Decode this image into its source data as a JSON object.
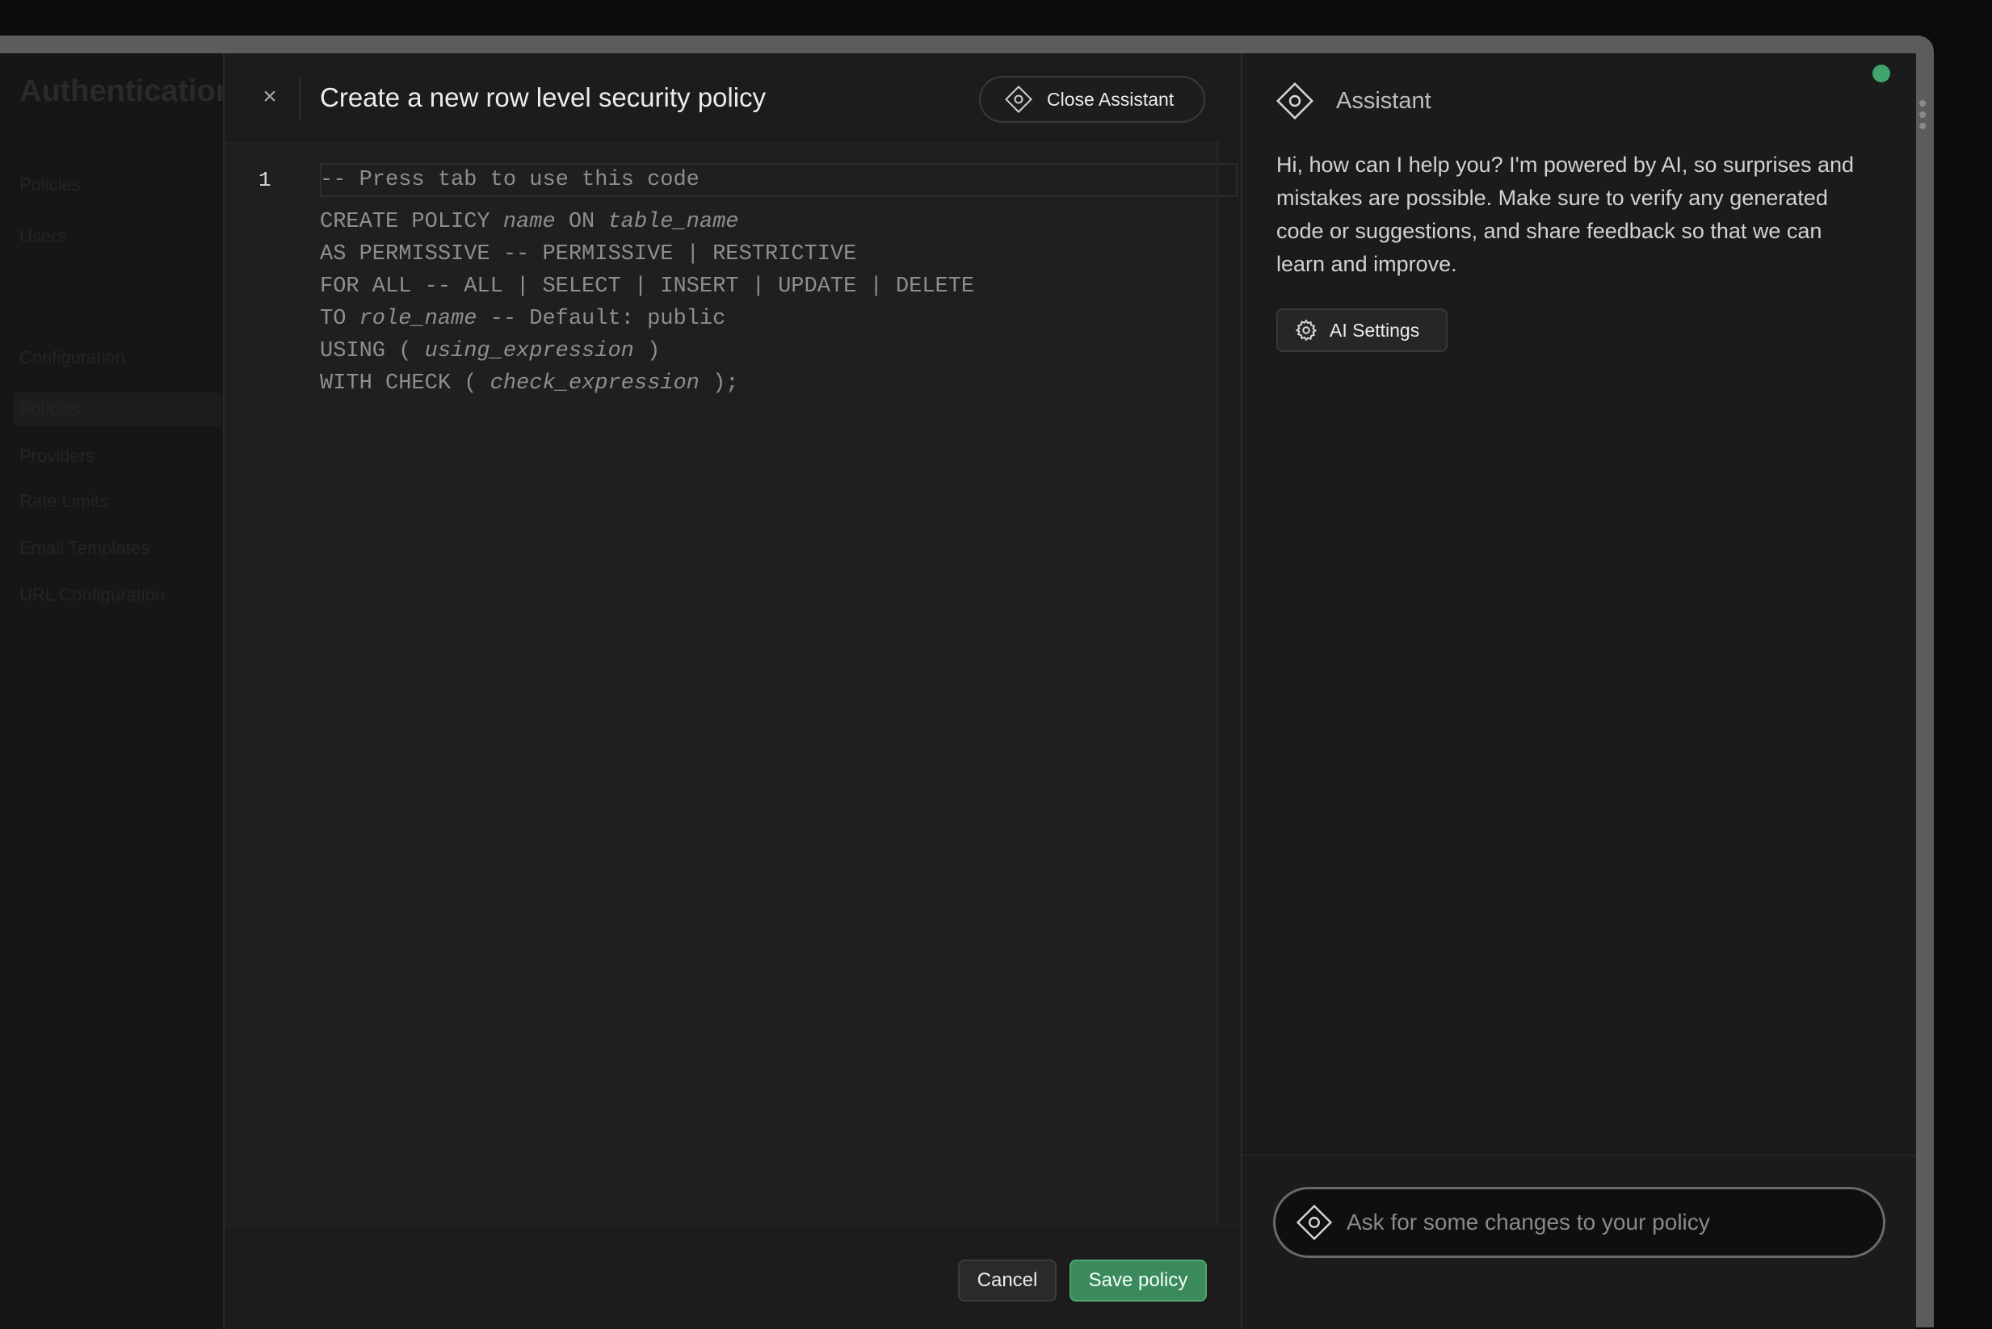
{
  "background": {
    "page_title": "Authentication",
    "sidebar_items": [
      "Policies",
      "Users",
      "Configuration",
      "Policies",
      "Providers",
      "Rate Limits",
      "Email Templates",
      "URL Configuration"
    ]
  },
  "sheet": {
    "title": "Create a new row level security policy",
    "close_label": "×",
    "close_assistant_label": "Close Assistant"
  },
  "editor": {
    "line_number": "1",
    "placeholder": "-- Press tab to use this code",
    "lines": [
      {
        "pre": "CREATE POLICY ",
        "it1": "name",
        "mid": " ON ",
        "it2": "table_name",
        "post": ""
      },
      {
        "pre": "AS PERMISSIVE -- PERMISSIVE | RESTRICTIVE",
        "it1": "",
        "mid": "",
        "it2": "",
        "post": ""
      },
      {
        "pre": "FOR ALL -- ALL | SELECT | INSERT | UPDATE | DELETE",
        "it1": "",
        "mid": "",
        "it2": "",
        "post": ""
      },
      {
        "pre": "TO ",
        "it1": "role_name",
        "mid": " -- Default: public",
        "it2": "",
        "post": ""
      },
      {
        "pre": "USING ( ",
        "it1": "using_expression",
        "mid": " )",
        "it2": "",
        "post": ""
      },
      {
        "pre": "WITH CHECK ( ",
        "it1": "check_expression",
        "mid": " );",
        "it2": "",
        "post": ""
      }
    ]
  },
  "footer": {
    "cancel_label": "Cancel",
    "save_label": "Save policy"
  },
  "assistant": {
    "title": "Assistant",
    "message": "Hi, how can I help you? I'm powered by AI, so surprises and mistakes are possible. Make sure to verify any generated code or suggestions, and share feedback so that we can learn and improve.",
    "ai_settings_label": "AI Settings",
    "input_placeholder": "Ask for some changes to your policy",
    "input_value": ""
  },
  "colors": {
    "accent_green": "#3a8a5c",
    "status_dot": "#3fa56a",
    "background": "#1c1c1c"
  },
  "icons": [
    "close-icon",
    "assistant-diamond-icon",
    "gear-icon"
  ]
}
